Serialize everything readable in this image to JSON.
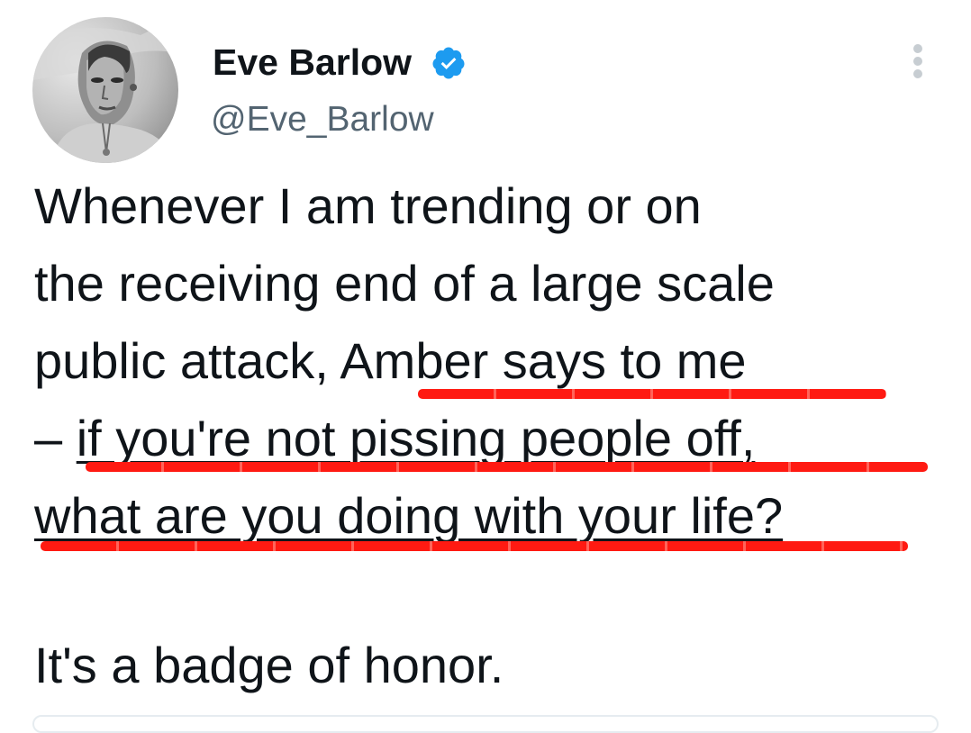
{
  "author": {
    "display_name": "Eve Barlow",
    "handle": "@Eve_Barlow",
    "verified": true,
    "avatar_icon": "profile-photo-grayscale"
  },
  "icons": {
    "verified": "verified-badge-icon",
    "more": "more-options-icon"
  },
  "colors": {
    "verified_blue": "#1d9bf0",
    "annotation_red": "#ff1a12",
    "handle_gray": "#536471"
  },
  "tweet": {
    "lines": [
      {
        "parts": [
          "Whenever I am trending or on"
        ]
      },
      {
        "parts": [
          "the receiving end of a large scale"
        ]
      },
      {
        "parts": [
          "public attack, ",
          "Amber says to me"
        ]
      },
      {
        "parts": [
          "– ",
          "if you're not pissing people off,"
        ]
      },
      {
        "parts": [
          "what are you doing with your life?"
        ]
      },
      {
        "parts": [
          "It's a badge of honor."
        ]
      }
    ]
  }
}
